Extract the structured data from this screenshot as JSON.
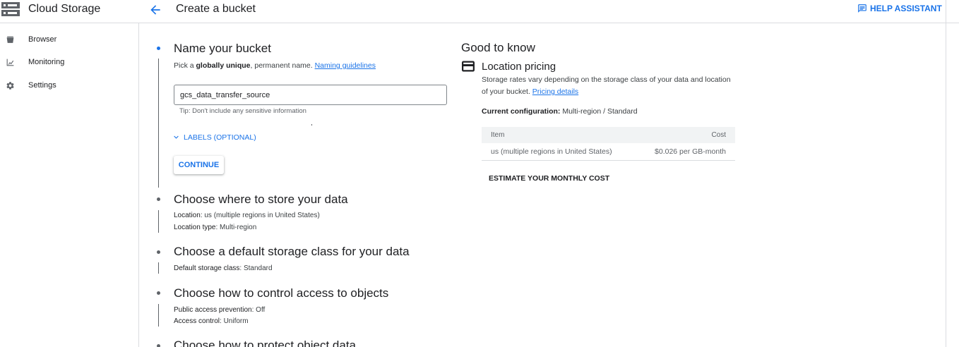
{
  "header": {
    "product_title": "Cloud Storage",
    "page_title": "Create a bucket",
    "help_label": "HELP ASSISTANT"
  },
  "sidebar": {
    "items": [
      {
        "label": "Browser",
        "icon": "bucket-icon"
      },
      {
        "label": "Monitoring",
        "icon": "chart-icon"
      },
      {
        "label": "Settings",
        "icon": "gear-icon"
      }
    ]
  },
  "steps": {
    "name": {
      "title": "Name your bucket",
      "desc_prefix": "Pick a ",
      "desc_bold": "globally unique",
      "desc_suffix": ", permanent name. ",
      "guidelines_link": "Naming guidelines",
      "input_value": "gcs_data_transfer_source",
      "tip": "Tip: Don't include any sensitive information",
      "labels_toggle": "LABELS (OPTIONAL)",
      "continue_label": "CONTINUE"
    },
    "location": {
      "title": "Choose where to store your data",
      "location_label": "Location",
      "location_value": ": us (multiple regions in United States)",
      "type_label": "Location type",
      "type_value": ": Multi-region"
    },
    "storage_class": {
      "title": "Choose a default storage class for your data",
      "class_label": "Default storage class",
      "class_value": ": Standard"
    },
    "access": {
      "title": "Choose how to control access to objects",
      "prevention_label": "Public access prevention",
      "prevention_value": ": Off",
      "control_label": "Access control",
      "control_value": ": Uniform"
    },
    "protect": {
      "title": "Choose how to protect object data"
    }
  },
  "good_to_know": {
    "title": "Good to know",
    "pricing_title": "Location pricing",
    "pricing_desc": "Storage rates vary depending on the storage class of your data and location of your bucket. ",
    "pricing_link": "Pricing details",
    "config_label": "Current configuration:",
    "config_value": " Multi-region / Standard",
    "table": {
      "headers": [
        "Item",
        "Cost"
      ],
      "rows": [
        {
          "item": "us (multiple regions in United States)",
          "cost": "$0.026 per GB-month"
        }
      ]
    },
    "estimate_label": "ESTIMATE YOUR MONTHLY COST"
  },
  "colors": {
    "accent": "#1a73e8",
    "text": "#202124",
    "muted": "#5f6368",
    "border": "#dadce0"
  }
}
